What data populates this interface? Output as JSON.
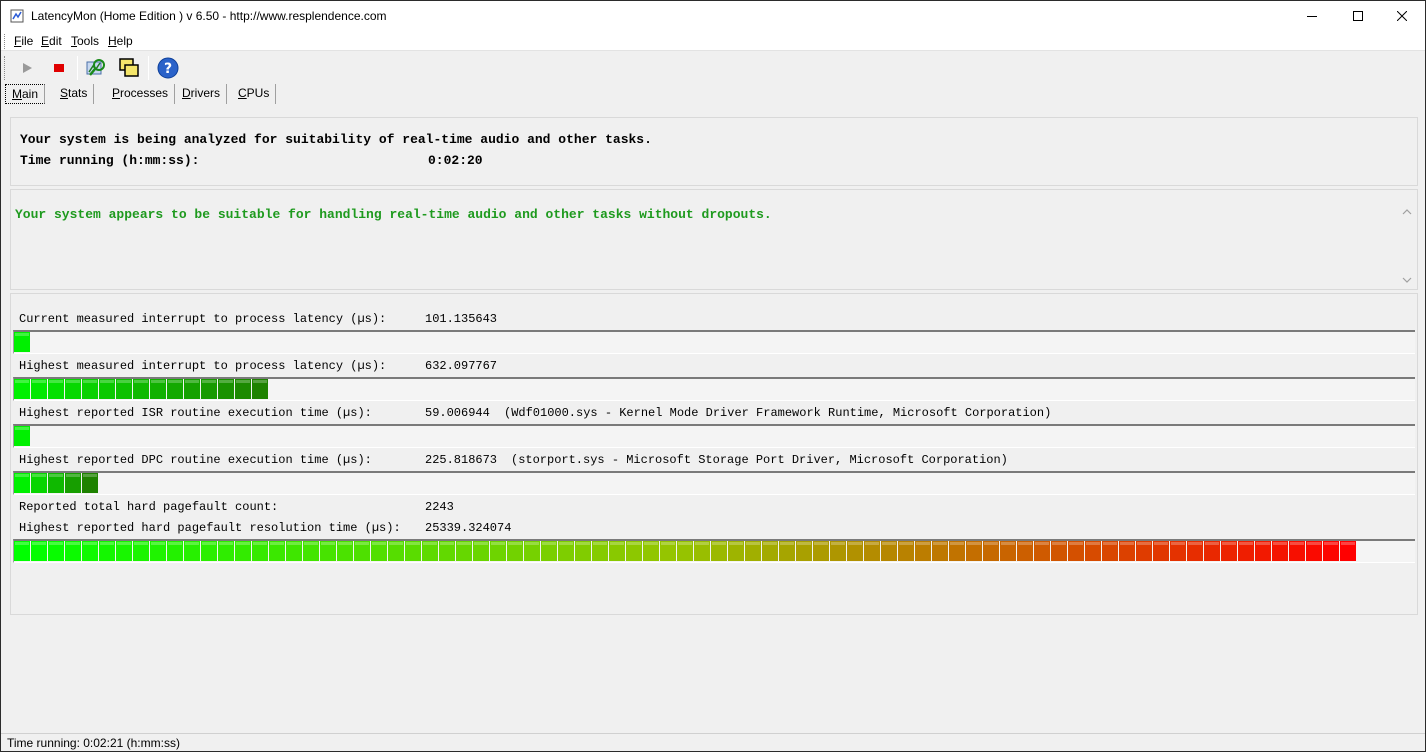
{
  "window": {
    "title": "LatencyMon  (Home Edition )  v 6.50 - http://www.resplendence.com"
  },
  "menu": [
    "File",
    "Edit",
    "Tools",
    "Help"
  ],
  "toolbar": {
    "icons": [
      "play-icon",
      "stop-icon",
      "report-icon",
      "windows-icon",
      "help-icon"
    ]
  },
  "tabs": [
    "Main",
    "Stats",
    "Processes",
    "Drivers",
    "CPUs"
  ],
  "status": {
    "analyzing": "Your system is being analyzed for suitability of real-time audio and other tasks.",
    "time_label": "Time running (h:mm:ss):",
    "time_value": "0:02:20"
  },
  "verdict": {
    "text": "Your system appears to be suitable for handling real-time audio and other tasks without dropouts.",
    "color": "#1e9a1e"
  },
  "metrics": {
    "current_latency": {
      "label": "Current measured interrupt to process latency (µs):",
      "value": "101.135643",
      "bar_segments": 1
    },
    "highest_latency": {
      "label": "Highest measured interrupt to process latency (µs):",
      "value": "632.097767",
      "bar_segments": 15
    },
    "isr": {
      "label": "Highest reported ISR routine execution time (µs):",
      "value": "59.006944",
      "detail": "(Wdf01000.sys - Kernel Mode Driver Framework Runtime, Microsoft Corporation)",
      "bar_segments": 1
    },
    "dpc": {
      "label": "Highest reported DPC routine execution time (µs):",
      "value": "225.818673",
      "detail": "(storport.sys - Microsoft Storage Port Driver, Microsoft Corporation)",
      "bar_segments": 5
    },
    "pagefault_count": {
      "label": "Reported total hard pagefault count:",
      "value": "2243"
    },
    "pagefault_time": {
      "label": "Highest reported hard pagefault resolution time (µs):",
      "value": "25339.324074",
      "bar_segments": 79
    }
  },
  "statusbar": {
    "text": "Time running: 0:02:21  (h:mm:ss)"
  }
}
